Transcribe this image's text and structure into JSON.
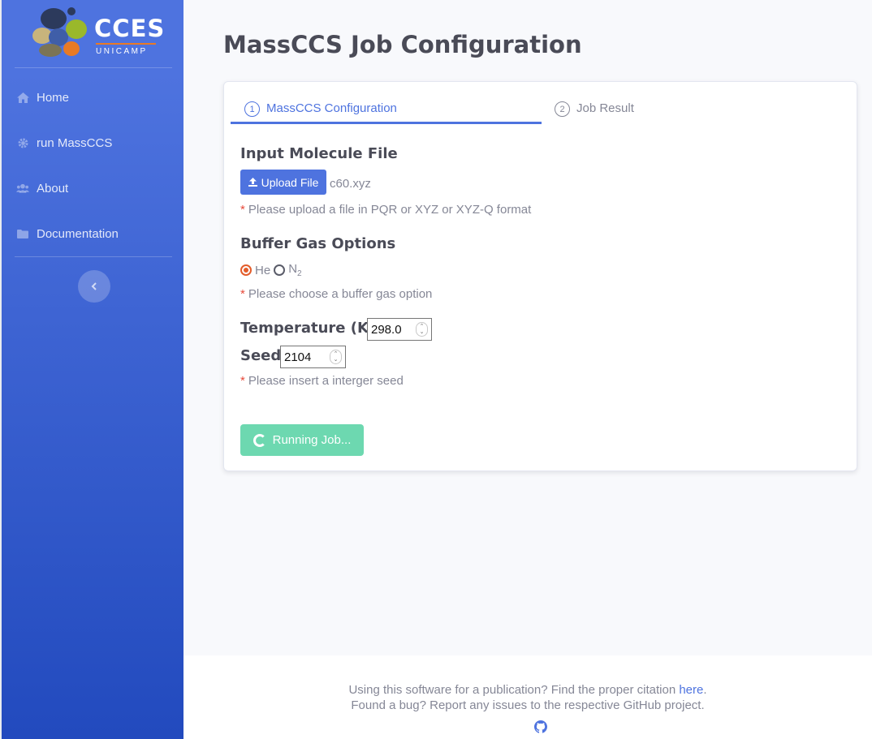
{
  "sidebar": {
    "brand": {
      "name": "CCES",
      "sub": "UNICAMP"
    },
    "items": [
      {
        "label": "Home",
        "icon": "home-icon"
      },
      {
        "label": "run MassCCS",
        "icon": "gear-icon"
      },
      {
        "label": "About",
        "icon": "users-icon"
      },
      {
        "label": "Documentation",
        "icon": "folder-icon"
      }
    ],
    "toggle_icon": "chevron-left-icon"
  },
  "page": {
    "title": "MassCCS Job Configuration"
  },
  "steps": [
    {
      "number": "1",
      "label": "MassCCS Configuration",
      "active": true
    },
    {
      "number": "2",
      "label": "Job Result",
      "active": false
    }
  ],
  "form": {
    "input_file": {
      "title": "Input Molecule File",
      "upload_label": "Upload File",
      "filename": "c60.xyz",
      "hint": "Please upload a file in PQR or XYZ or XYZ-Q format"
    },
    "buffer_gas": {
      "title": "Buffer Gas Options",
      "options": [
        "He",
        "N",
        "2"
      ],
      "selected": "He",
      "hint": "Please choose a buffer gas option"
    },
    "temperature": {
      "label": "Temperature (K)",
      "value": "298.0"
    },
    "seed": {
      "label": "Seed",
      "value": "2104",
      "hint": "Please insert a interger seed"
    },
    "hint_marker": "*",
    "run_label": "Running Job..."
  },
  "footer": {
    "line1_text": "Using this software for a publication? Find the proper citation",
    "line1_link": "here",
    "line1_end": ".",
    "line2": "Found a bug? Report any issues to the respective GitHub project.",
    "icon": "github-icon"
  },
  "colors": {
    "primary": "#4e73df",
    "success_disabled": "#6dd8b0",
    "danger": "#e74a3b",
    "radio_checked": "#e35d2b",
    "brand_orange": "#e87a25"
  }
}
